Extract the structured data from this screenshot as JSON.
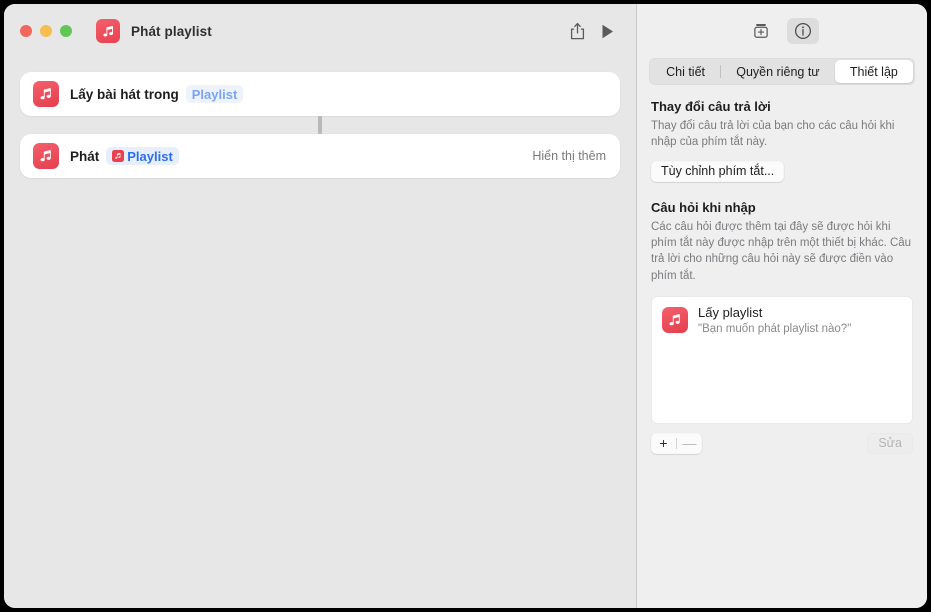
{
  "window": {
    "title": "Phát playlist",
    "app_icon": "music-note-icon",
    "traffic_lights": [
      "close-button",
      "minimize-button",
      "zoom-button"
    ],
    "toolbar": {
      "share_label": "share-icon",
      "run_label": "play-icon"
    }
  },
  "editor": {
    "actions": [
      {
        "icon": "music-note-icon",
        "label": "Lấy bài hát trong",
        "token": "Playlist",
        "token_style": "placeholder",
        "token_icon": null,
        "trailing": ""
      },
      {
        "icon": "music-note-icon",
        "label": "Phát",
        "token": "Playlist",
        "token_style": "filled",
        "token_icon": "music-note-mini-icon",
        "trailing": "Hiển thị thêm"
      }
    ]
  },
  "inspector": {
    "toolbar_buttons": [
      {
        "name": "add-action-icon",
        "active": false
      },
      {
        "name": "info-icon",
        "active": true
      }
    ],
    "tabs": [
      {
        "label": "Chi tiết",
        "selected": false
      },
      {
        "label": "Quyền riêng tư",
        "selected": false
      },
      {
        "label": "Thiết lập",
        "selected": true
      }
    ],
    "sections": [
      {
        "title": "Thay đổi câu trả lời",
        "description": "Thay đổi câu trả lời của bạn cho các câu hỏi khi nhập của phím tắt này.",
        "button": "Tùy chỉnh phím tắt..."
      },
      {
        "title": "Câu hỏi khi nhập",
        "description": "Các câu hỏi được thêm tại đây sẽ được hỏi khi phím tắt này được nhập trên một thiết bị khác. Câu trả lời cho những câu hỏi này sẽ được điền vào phím tắt."
      }
    ],
    "questions": [
      {
        "icon": "music-note-icon",
        "title": "Lấy playlist",
        "prompt": "\"Bạn muốn phát playlist nào?\""
      }
    ],
    "list_controls": {
      "add_label": "+",
      "remove_label": "—",
      "edit_label": "Sửa"
    }
  },
  "colors": {
    "accent_red": "#e8414f",
    "token_blue": "#2a6ef0",
    "token_blue_light": "#7ba5f0",
    "window_bg": "#e8e7e7",
    "inspector_bg": "#f0efef"
  }
}
